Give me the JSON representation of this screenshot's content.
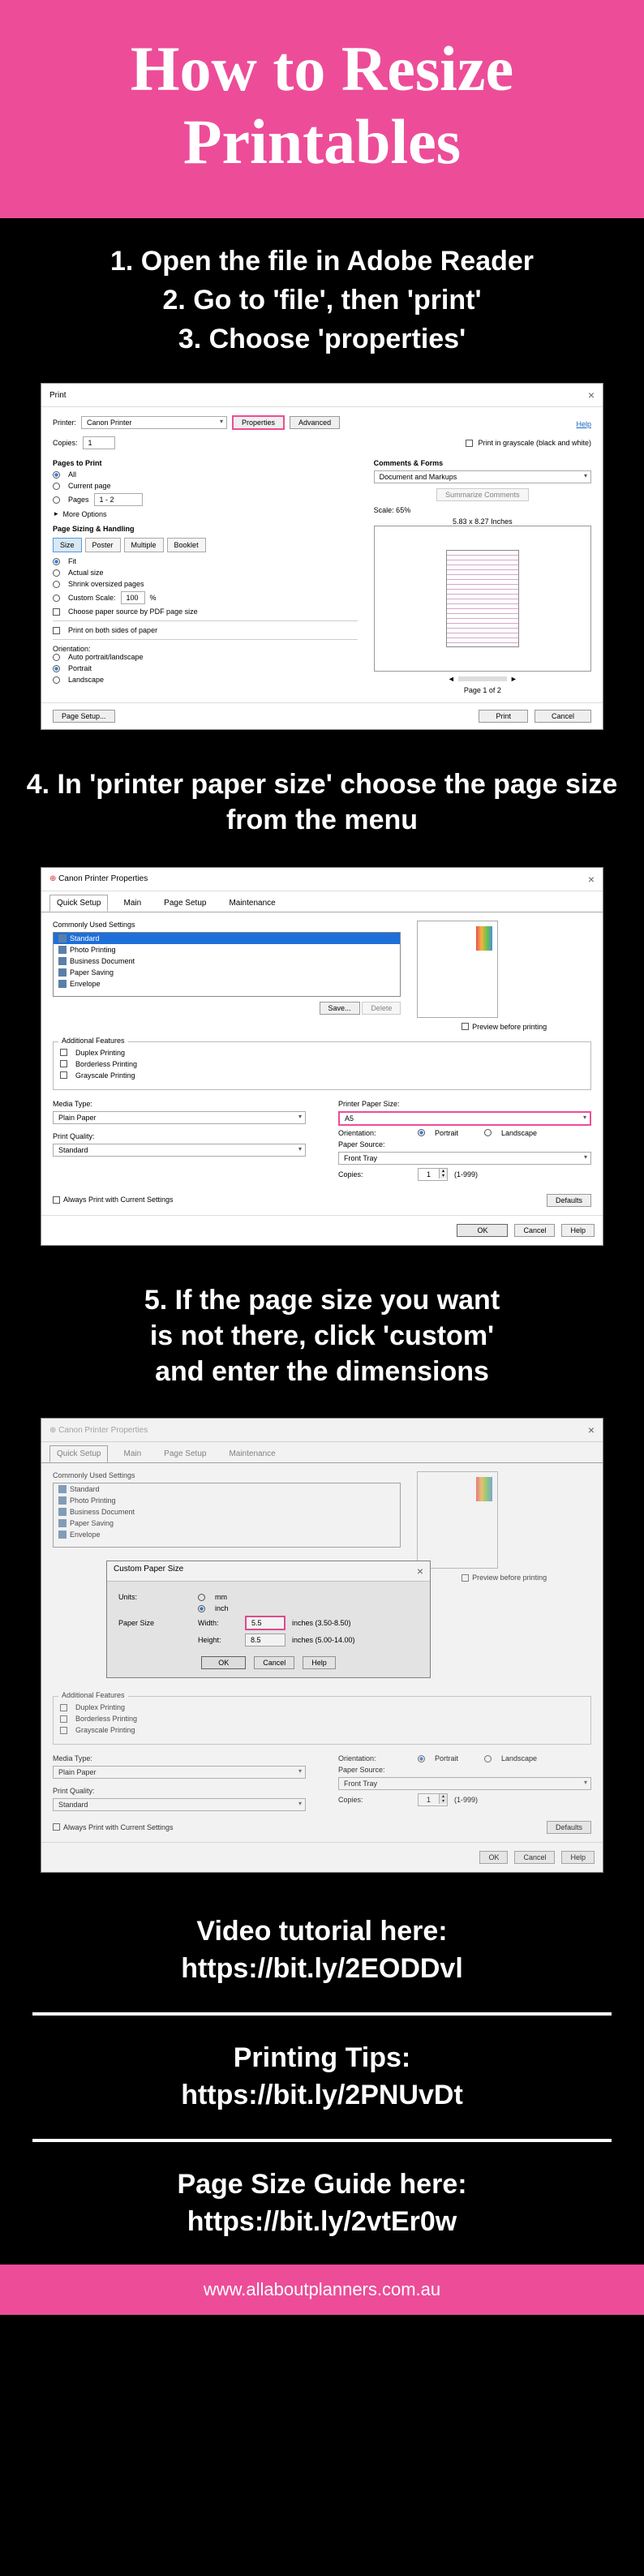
{
  "header": {
    "line1": "How to Resize",
    "line2": "Printables"
  },
  "step_intro": {
    "s1": "1. Open the file in Adobe Reader",
    "s2": "2. Go to 'file', then 'print'",
    "s3": "3. Choose 'properties'"
  },
  "print_dialog": {
    "title": "Print",
    "help": "Help",
    "printer_label": "Printer:",
    "printer_value": "Canon          Printer",
    "copies_label": "Copies:",
    "copies_value": "1",
    "properties_btn": "Properties",
    "advanced_btn": "Advanced",
    "grayscale": "Print in grayscale (black and white)",
    "pages_header": "Pages to Print",
    "all": "All",
    "current": "Current page",
    "pages": "Pages",
    "pages_range": "1 - 2",
    "more_options": "More Options",
    "sizing_header": "Page Sizing & Handling",
    "tab_size": "Size",
    "tab_poster": "Poster",
    "tab_multiple": "Multiple",
    "tab_booklet": "Booklet",
    "fit": "Fit",
    "actual": "Actual size",
    "shrink": "Shrink oversized pages",
    "custom_scale": "Custom Scale:",
    "custom_scale_val": "100",
    "pct": "%",
    "choose_source": "Choose paper source by PDF page size",
    "both_sides": "Print on both sides of paper",
    "orientation_header": "Orientation:",
    "auto_orient": "Auto portrait/landscape",
    "portrait": "Portrait",
    "landscape": "Landscape",
    "comments_header": "Comments & Forms",
    "comments_value": "Document and Markups",
    "summarize": "Summarize Comments",
    "scale": "Scale: 65%",
    "page_dims": "5.83 x 8.27 Inches",
    "page_of": "Page 1 of 2",
    "page_setup": "Page Setup...",
    "print_btn": "Print",
    "cancel_btn": "Cancel"
  },
  "step4": "4. In 'printer paper size' choose the page size from the menu",
  "props_dialog": {
    "window": "Canon          Printer Properties",
    "tabs": {
      "quick": "Quick Setup",
      "main": "Main",
      "page": "Page Setup",
      "maint": "Maintenance"
    },
    "commonly_used": "Commonly Used Settings",
    "items": {
      "standard": "Standard",
      "photo": "Photo Printing",
      "business": "Business Document",
      "paper_saving": "Paper Saving",
      "envelope": "Envelope"
    },
    "save_btn": "Save...",
    "delete_btn": "Delete",
    "preview_chk": "Preview before printing",
    "additional": "Additional Features",
    "duplex": "Duplex Printing",
    "borderless": "Borderless Printing",
    "grayscale": "Grayscale Printing",
    "media_type": "Media Type:",
    "media_val": "Plain Paper",
    "quality": "Print Quality:",
    "quality_val": "Standard",
    "paper_size": "Printer Paper Size:",
    "paper_size_val": "A5",
    "orientation": "Orientation:",
    "portrait": "Portrait",
    "landscape": "Landscape",
    "source": "Paper Source:",
    "source_val": "Front Tray",
    "copies": "Copies:",
    "copies_val": "1",
    "copies_range": "(1-999)",
    "always": "Always Print with Current Settings",
    "defaults": "Defaults",
    "ok": "OK",
    "cancel": "Cancel",
    "help": "Help"
  },
  "step5": {
    "l1": "5. If the page size you want",
    "l2": "is not there, click 'custom'",
    "l3": "and enter the dimensions"
  },
  "custom_dialog": {
    "title": "Custom Paper Size",
    "units": "Units:",
    "mm": "mm",
    "inch": "inch",
    "paper_size": "Paper Size",
    "width": "Width:",
    "width_val": "5.5",
    "width_range": "inches (3.50-8.50)",
    "height": "Height:",
    "height_val": "8.5",
    "height_range": "inches (5.00-14.00)",
    "ok": "OK",
    "cancel": "Cancel",
    "help": "Help"
  },
  "links": {
    "video_l1": "Video tutorial here:",
    "video_l2": "https://bit.ly/2EODDvl",
    "tips_l1": "Printing Tips:",
    "tips_l2": "https://bit.ly/2PNUvDt",
    "guide_l1": "Page Size Guide here:",
    "guide_l2": "https://bit.ly/2vtEr0w"
  },
  "footer": "www.allaboutplanners.com.au"
}
